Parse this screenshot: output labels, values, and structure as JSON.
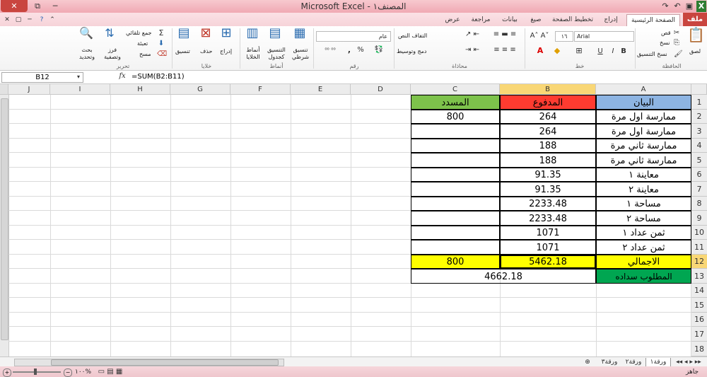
{
  "window": {
    "title": "Microsoft Excel - المصنف١",
    "close_label": "✕",
    "maximize_label": "⧉",
    "minimize_label": "─"
  },
  "ribbon_tabs": [
    {
      "label": "ملف",
      "active": false
    },
    {
      "label": "الصفحة الرئيسية",
      "active": true
    },
    {
      "label": "إدراج",
      "active": false
    },
    {
      "label": "تخطيط الصفحة",
      "active": false
    },
    {
      "label": "صيغ",
      "active": false
    },
    {
      "label": "بيانات",
      "active": false
    },
    {
      "label": "مراجعة",
      "active": false
    },
    {
      "label": "عرض",
      "active": false
    }
  ],
  "ribbon": {
    "clipboard": {
      "group": "الحافظة",
      "paste": "لصق",
      "cut": "قص",
      "copy": "نسخ",
      "format_painter": "نسخ التنسيق"
    },
    "font": {
      "group": "خط",
      "font_name": "Arial",
      "font_size": "١٦",
      "bold": "B",
      "italic": "I",
      "underline": "U"
    },
    "alignment": {
      "group": "محاذاة",
      "wrap_text": "التفاف النص",
      "merge_center": "دمج وتوسيط"
    },
    "number": {
      "group": "رقم",
      "format": "عام",
      "percent": "%",
      "comma": ","
    },
    "styles": {
      "group": "أنماط",
      "conditional": "تنسيق شرطي",
      "format_table": "التنسيق كجدول",
      "cell_styles": "أنماط الخلايا"
    },
    "cells": {
      "group": "خلايا",
      "insert": "إدراج",
      "delete": "حذف",
      "format": "تنسيق"
    },
    "editing": {
      "group": "تحرير",
      "autosum": "جمع تلقائي",
      "fill": "تعبئة",
      "clear": "مسح",
      "sort_filter": "فرز وتصفية",
      "find_select": "بحث وتحديد"
    }
  },
  "formula_bar": {
    "name_box": "B12",
    "fx": "fx",
    "formula": "=SUM(B2:B11)"
  },
  "columns": [
    "A",
    "B",
    "C",
    "D",
    "E",
    "F",
    "G",
    "H",
    "I",
    "J"
  ],
  "rows": [
    "1",
    "2",
    "3",
    "4",
    "5",
    "6",
    "7",
    "8",
    "9",
    "10",
    "11",
    "12",
    "13",
    "14",
    "15",
    "16",
    "17",
    "18"
  ],
  "active_cell": "B12",
  "table": {
    "header": {
      "A": "البيان",
      "B": "المدفوع",
      "C": "المسدد"
    },
    "rows": [
      {
        "A": "ممارسة اول مرة",
        "B": "264",
        "C": "800"
      },
      {
        "A": "ممارسة اول مرة",
        "B": "264",
        "C": ""
      },
      {
        "A": "ممارسة ثاني مرة",
        "B": "188",
        "C": ""
      },
      {
        "A": "ممارسة ثاني مرة",
        "B": "188",
        "C": ""
      },
      {
        "A": "معاينة ١",
        "B": "91.35",
        "C": ""
      },
      {
        "A": "معاينة ٢",
        "B": "91.35",
        "C": ""
      },
      {
        "A": "مساحة ١",
        "B": "2233.48",
        "C": ""
      },
      {
        "A": "مساحة ٢",
        "B": "2233.48",
        "C": ""
      },
      {
        "A": "ثمن عداد ١",
        "B": "1071",
        "C": ""
      },
      {
        "A": "ثمن عداد ٢",
        "B": "1071",
        "C": ""
      }
    ],
    "total": {
      "A": "الاجمالي",
      "B": "5462.18",
      "C": "800"
    },
    "remaining": {
      "A": "المطلوب سداده",
      "BC": "4662.18"
    }
  },
  "sheets": [
    {
      "label": "ورقة١",
      "active": true
    },
    {
      "label": "ورقة٢",
      "active": false
    },
    {
      "label": "ورقة٣",
      "active": false
    }
  ],
  "status": {
    "ready": "جاهز",
    "zoom": "١٠٠%"
  },
  "colors": {
    "header_A": "#8db4e2",
    "header_B": "#ff3b30",
    "header_C": "#7dc24b",
    "total_row": "#ffff00",
    "remaining_A": "#00a651",
    "selection_header": "#f9d776"
  }
}
